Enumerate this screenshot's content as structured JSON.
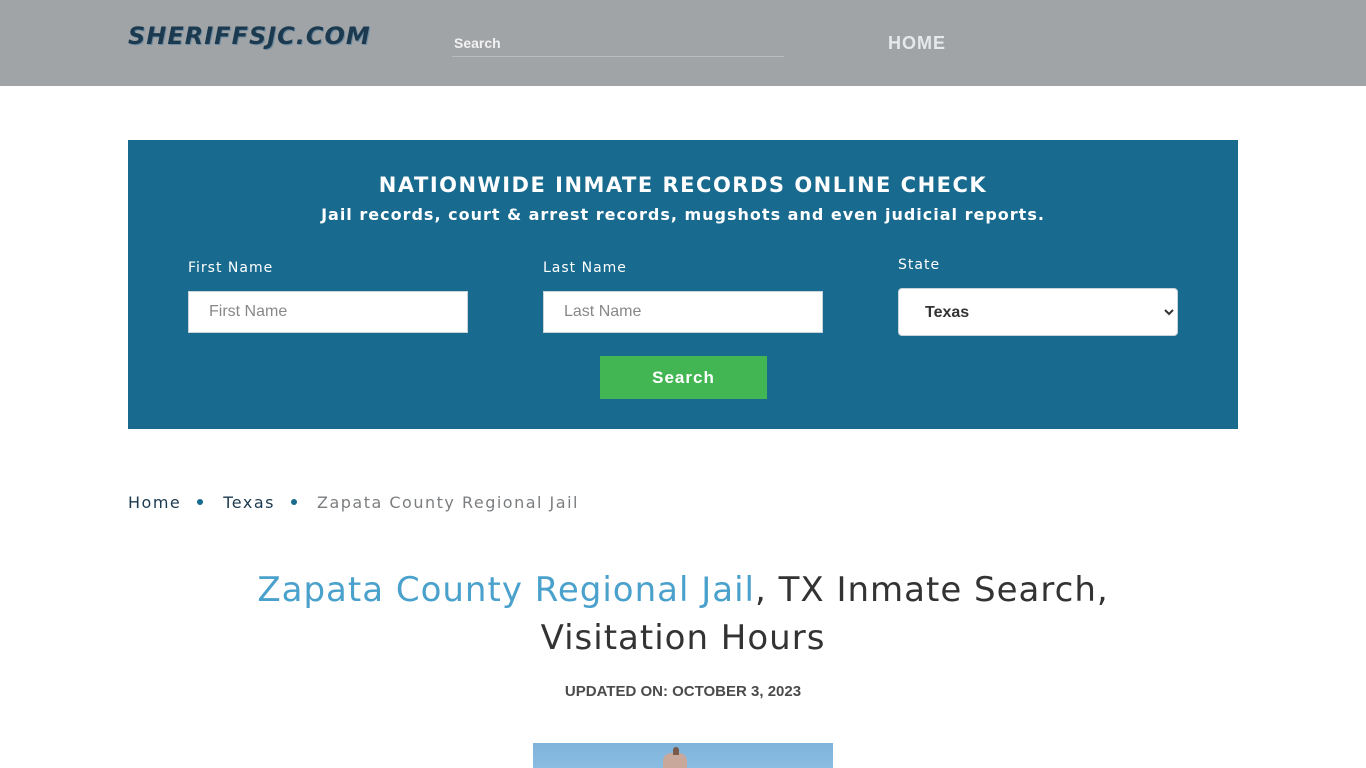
{
  "header": {
    "logo_text": "SHERIFFSJC.COM",
    "search_placeholder": "Search",
    "nav_home": "HOME"
  },
  "banner": {
    "title": "NATIONWIDE INMATE RECORDS ONLINE CHECK",
    "subtitle": "Jail records, court & arrest records, mugshots and even judicial reports.",
    "first_name_label": "First Name",
    "first_name_placeholder": "First Name",
    "last_name_label": "Last Name",
    "last_name_placeholder": "Last Name",
    "state_label": "State",
    "state_value": "Texas",
    "search_button": "Search"
  },
  "breadcrumb": {
    "items": [
      "Home",
      "Texas",
      "Zapata County Regional Jail"
    ]
  },
  "article": {
    "title_link": "Zapata County Regional Jail",
    "title_rest": ", TX Inmate Search, Visitation Hours",
    "updated": "UPDATED ON: OCTOBER 3, 2023"
  },
  "colors": {
    "header_bg": "#a0a4a7",
    "banner_bg": "#186a8f",
    "button_green": "#43b654",
    "title_link": "#4aa1cc"
  }
}
